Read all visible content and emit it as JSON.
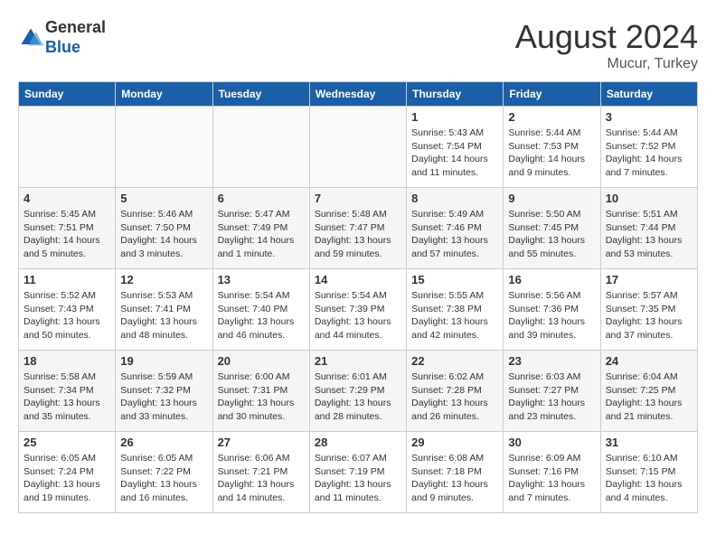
{
  "header": {
    "logo_general": "General",
    "logo_blue": "Blue",
    "month_year": "August 2024",
    "location": "Mucur, Turkey"
  },
  "days_of_week": [
    "Sunday",
    "Monday",
    "Tuesday",
    "Wednesday",
    "Thursday",
    "Friday",
    "Saturday"
  ],
  "weeks": [
    [
      {
        "day": "",
        "info": "",
        "empty": true
      },
      {
        "day": "",
        "info": "",
        "empty": true
      },
      {
        "day": "",
        "info": "",
        "empty": true
      },
      {
        "day": "",
        "info": "",
        "empty": true
      },
      {
        "day": "1",
        "info": "Sunrise: 5:43 AM\nSunset: 7:54 PM\nDaylight: 14 hours and 11 minutes.",
        "empty": false
      },
      {
        "day": "2",
        "info": "Sunrise: 5:44 AM\nSunset: 7:53 PM\nDaylight: 14 hours and 9 minutes.",
        "empty": false
      },
      {
        "day": "3",
        "info": "Sunrise: 5:44 AM\nSunset: 7:52 PM\nDaylight: 14 hours and 7 minutes.",
        "empty": false
      }
    ],
    [
      {
        "day": "4",
        "info": "Sunrise: 5:45 AM\nSunset: 7:51 PM\nDaylight: 14 hours and 5 minutes.",
        "empty": false
      },
      {
        "day": "5",
        "info": "Sunrise: 5:46 AM\nSunset: 7:50 PM\nDaylight: 14 hours and 3 minutes.",
        "empty": false
      },
      {
        "day": "6",
        "info": "Sunrise: 5:47 AM\nSunset: 7:49 PM\nDaylight: 14 hours and 1 minute.",
        "empty": false
      },
      {
        "day": "7",
        "info": "Sunrise: 5:48 AM\nSunset: 7:47 PM\nDaylight: 13 hours and 59 minutes.",
        "empty": false
      },
      {
        "day": "8",
        "info": "Sunrise: 5:49 AM\nSunset: 7:46 PM\nDaylight: 13 hours and 57 minutes.",
        "empty": false
      },
      {
        "day": "9",
        "info": "Sunrise: 5:50 AM\nSunset: 7:45 PM\nDaylight: 13 hours and 55 minutes.",
        "empty": false
      },
      {
        "day": "10",
        "info": "Sunrise: 5:51 AM\nSunset: 7:44 PM\nDaylight: 13 hours and 53 minutes.",
        "empty": false
      }
    ],
    [
      {
        "day": "11",
        "info": "Sunrise: 5:52 AM\nSunset: 7:43 PM\nDaylight: 13 hours and 50 minutes.",
        "empty": false
      },
      {
        "day": "12",
        "info": "Sunrise: 5:53 AM\nSunset: 7:41 PM\nDaylight: 13 hours and 48 minutes.",
        "empty": false
      },
      {
        "day": "13",
        "info": "Sunrise: 5:54 AM\nSunset: 7:40 PM\nDaylight: 13 hours and 46 minutes.",
        "empty": false
      },
      {
        "day": "14",
        "info": "Sunrise: 5:54 AM\nSunset: 7:39 PM\nDaylight: 13 hours and 44 minutes.",
        "empty": false
      },
      {
        "day": "15",
        "info": "Sunrise: 5:55 AM\nSunset: 7:38 PM\nDaylight: 13 hours and 42 minutes.",
        "empty": false
      },
      {
        "day": "16",
        "info": "Sunrise: 5:56 AM\nSunset: 7:36 PM\nDaylight: 13 hours and 39 minutes.",
        "empty": false
      },
      {
        "day": "17",
        "info": "Sunrise: 5:57 AM\nSunset: 7:35 PM\nDaylight: 13 hours and 37 minutes.",
        "empty": false
      }
    ],
    [
      {
        "day": "18",
        "info": "Sunrise: 5:58 AM\nSunset: 7:34 PM\nDaylight: 13 hours and 35 minutes.",
        "empty": false
      },
      {
        "day": "19",
        "info": "Sunrise: 5:59 AM\nSunset: 7:32 PM\nDaylight: 13 hours and 33 minutes.",
        "empty": false
      },
      {
        "day": "20",
        "info": "Sunrise: 6:00 AM\nSunset: 7:31 PM\nDaylight: 13 hours and 30 minutes.",
        "empty": false
      },
      {
        "day": "21",
        "info": "Sunrise: 6:01 AM\nSunset: 7:29 PM\nDaylight: 13 hours and 28 minutes.",
        "empty": false
      },
      {
        "day": "22",
        "info": "Sunrise: 6:02 AM\nSunset: 7:28 PM\nDaylight: 13 hours and 26 minutes.",
        "empty": false
      },
      {
        "day": "23",
        "info": "Sunrise: 6:03 AM\nSunset: 7:27 PM\nDaylight: 13 hours and 23 minutes.",
        "empty": false
      },
      {
        "day": "24",
        "info": "Sunrise: 6:04 AM\nSunset: 7:25 PM\nDaylight: 13 hours and 21 minutes.",
        "empty": false
      }
    ],
    [
      {
        "day": "25",
        "info": "Sunrise: 6:05 AM\nSunset: 7:24 PM\nDaylight: 13 hours and 19 minutes.",
        "empty": false
      },
      {
        "day": "26",
        "info": "Sunrise: 6:05 AM\nSunset: 7:22 PM\nDaylight: 13 hours and 16 minutes.",
        "empty": false
      },
      {
        "day": "27",
        "info": "Sunrise: 6:06 AM\nSunset: 7:21 PM\nDaylight: 13 hours and 14 minutes.",
        "empty": false
      },
      {
        "day": "28",
        "info": "Sunrise: 6:07 AM\nSunset: 7:19 PM\nDaylight: 13 hours and 11 minutes.",
        "empty": false
      },
      {
        "day": "29",
        "info": "Sunrise: 6:08 AM\nSunset: 7:18 PM\nDaylight: 13 hours and 9 minutes.",
        "empty": false
      },
      {
        "day": "30",
        "info": "Sunrise: 6:09 AM\nSunset: 7:16 PM\nDaylight: 13 hours and 7 minutes.",
        "empty": false
      },
      {
        "day": "31",
        "info": "Sunrise: 6:10 AM\nSunset: 7:15 PM\nDaylight: 13 hours and 4 minutes.",
        "empty": false
      }
    ]
  ]
}
